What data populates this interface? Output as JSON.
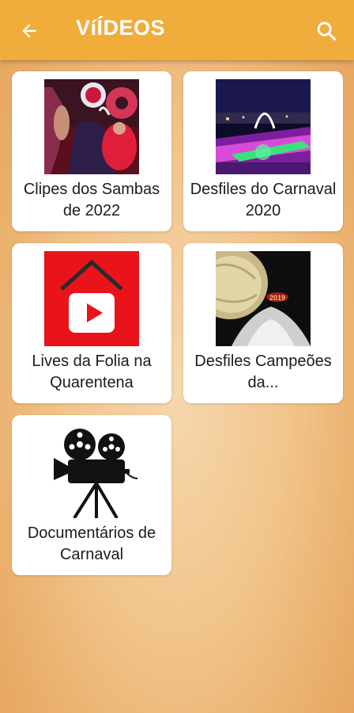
{
  "appbar": {
    "title": "VíÍDEOS",
    "back_icon": "arrow-left-icon",
    "search_icon": "search-icon",
    "color": "#f0ad3c"
  },
  "categories": [
    {
      "label": "Clipes dos Sambas de 2022",
      "thumbnail": "carnival-costume-photo"
    },
    {
      "label": "Desfiles do Carnaval 2020",
      "thumbnail": "sambadrome-night-photo"
    },
    {
      "label": "Lives da Folia na Quarentena",
      "thumbnail": "house-play-icon",
      "color": "#e8141a"
    },
    {
      "label": "Desfiles Campeões da...",
      "thumbnail": "parade-float-photo"
    },
    {
      "label": "Documentários de Carnaval",
      "thumbnail": "film-camera-icon"
    }
  ]
}
